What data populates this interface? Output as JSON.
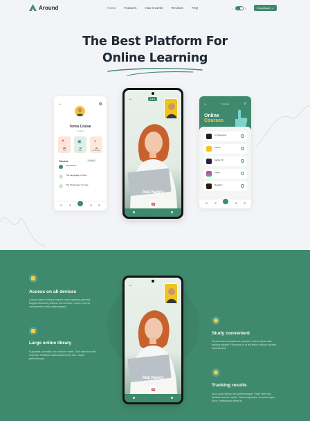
{
  "brand": {
    "name": "Around",
    "accent": "#3f8a6e",
    "highlight": "#f2d14a"
  },
  "nav": {
    "links": [
      "Home",
      "Features",
      "How it works",
      "Reviews",
      "FAQ"
    ],
    "active_index": 0,
    "download_label": "Download"
  },
  "hero": {
    "title_line1": "The Best Platform For",
    "title_line2": "Online Learning"
  },
  "profile_card": {
    "name": "Tomo Cruise",
    "stats": [
      {
        "value": "4/5",
        "label": "Test"
      },
      {
        "value": "12",
        "label": "Notes"
      },
      {
        "value": "+9",
        "label": "Certificates"
      }
    ],
    "section_title": "Course",
    "section_tag": "Details",
    "lessons": [
      {
        "title": "Introduction",
        "sub": ""
      },
      {
        "title": "The Language of Color",
        "sub": ""
      },
      {
        "title": "The Psychology of Color",
        "sub": ""
      }
    ]
  },
  "call": {
    "name": "Ada Nancy",
    "sub": "Business Coach"
  },
  "courses_card": {
    "label": "Courses",
    "title_line1": "Online",
    "title_line2": "Courses",
    "courses": [
      {
        "title": "UX Designing",
        "icon_color": "#1f1f1f"
      },
      {
        "title": "Sketch",
        "icon_color": "#f5c518"
      },
      {
        "title": "Adobe XD",
        "icon_color": "#2d1f3d"
      },
      {
        "title": "Figma",
        "icon_color": "#ffffff"
      },
      {
        "title": "Illustrator",
        "icon_color": "#2b1a09"
      }
    ]
  },
  "features": [
    {
      "title": "Access on all devices",
      "text": "Cursus dictum neque mauris risus egestas placerat feugiat tincidunt pulvinar elementum. Lorem viverra consectetur tortor pellentesque."
    },
    {
      "title": "Large online library",
      "text": "Vulputate convallis odio dictum mattis. Sed ante sed nisl rhoncus. Facilisis malesuada morbi non neque pellentesque."
    },
    {
      "title": "Study convenient",
      "text": "Fermentum convallis eu posuere rutrum lacus odio facilisis aliquet. Rhoncus in in elit tellus velit eu laoreet lobortis sed."
    },
    {
      "title": "Tracking results",
      "text": "Arcu cras rutrum nec pellentesque. Vitae nibh nec facilisis laoreet metus. Tellus dignissim at amet turpis dolor, malesuada tempus."
    }
  ]
}
